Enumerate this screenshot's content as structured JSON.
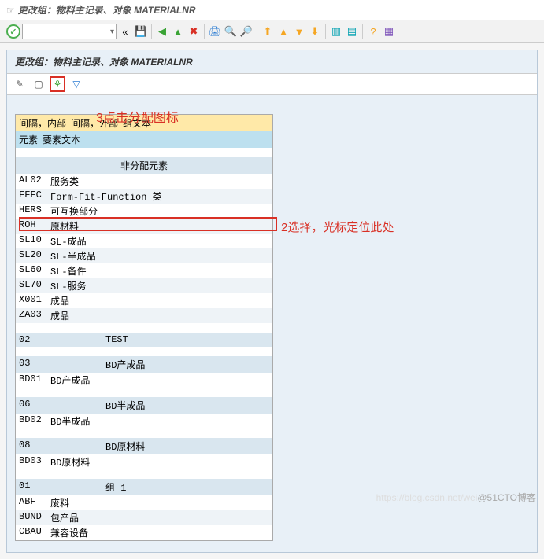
{
  "window": {
    "title": "更改组：物料主记录、对象 MATERIALNR"
  },
  "panel": {
    "title": "更改组：物料主记录、对象 MATERIALNR"
  },
  "annotations": {
    "a1": "3点击分配图标",
    "a2": "2选择，光标定位此处"
  },
  "table": {
    "header1": [
      "间隔，内部",
      "间隔，外部",
      "组文本"
    ],
    "header2": [
      "元素",
      "要素文本"
    ],
    "unassigned_title": "非分配元素",
    "unassigned": [
      {
        "code": "AL02",
        "text": "服务类"
      },
      {
        "code": "FFFC",
        "text": "Form-Fit-Function 类"
      },
      {
        "code": "HERS",
        "text": "可互换部分"
      },
      {
        "code": "ROH",
        "text": "原材料"
      },
      {
        "code": "SL10",
        "text": "SL-成品"
      },
      {
        "code": "SL20",
        "text": "SL-半成品"
      },
      {
        "code": "SL60",
        "text": "SL-备件"
      },
      {
        "code": "SL70",
        "text": "SL-服务"
      },
      {
        "code": "X001",
        "text": "成品"
      },
      {
        "code": "ZA03",
        "text": "成品"
      }
    ],
    "groups": [
      {
        "no": "02",
        "name": "TEST",
        "rows": []
      },
      {
        "no": "03",
        "name": "BD产成品",
        "rows": [
          {
            "code": "BD01",
            "text": "BD产成品"
          }
        ]
      },
      {
        "no": "06",
        "name": "BD半成品",
        "rows": [
          {
            "code": "BD02",
            "text": "BD半成品"
          }
        ]
      },
      {
        "no": "08",
        "name": "BD原材料",
        "rows": [
          {
            "code": "BD03",
            "text": "BD原材料"
          }
        ]
      },
      {
        "no": "01",
        "name": "组 1",
        "rows": [
          {
            "code": "ABF",
            "text": "废料"
          },
          {
            "code": "BUND",
            "text": "包产品"
          },
          {
            "code": "CBAU",
            "text": "兼容设备"
          }
        ]
      }
    ]
  },
  "watermark": {
    "light": "https://blog.csdn.net/wei",
    "dark": "@51CTO博客"
  }
}
